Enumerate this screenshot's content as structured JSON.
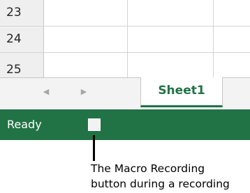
{
  "grid": {
    "rows": [
      {
        "num": "23"
      },
      {
        "num": "24"
      },
      {
        "num": "25"
      }
    ]
  },
  "tabs": {
    "prev_icon": "scroll-left-arrow",
    "next_icon": "scroll-right-arrow",
    "sheet_label": "Sheet1"
  },
  "status_bar": {
    "status": "Ready",
    "macro_button_icon": "stop-recording-square"
  },
  "callout": {
    "line1": "The Macro Recording",
    "line2": "button during a recording"
  },
  "colors": {
    "accent": "#217346",
    "status_bg": "#217346",
    "header_bg": "#efefef",
    "gridline": "#d4d4d4"
  }
}
